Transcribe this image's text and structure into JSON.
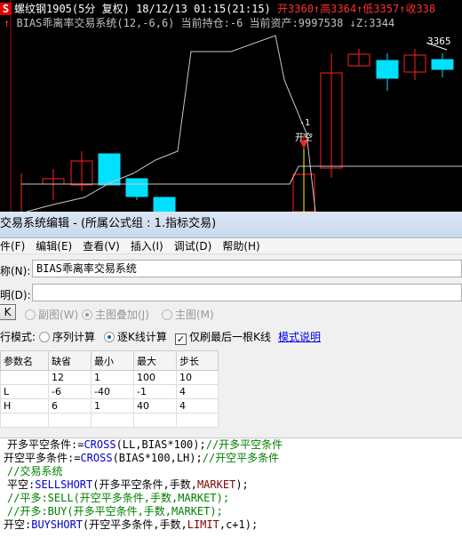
{
  "chart": {
    "header1": {
      "symbol_icon": "S",
      "symbol": "螺纹钢1905(5分",
      "adjust": "复权)",
      "datetime": "18/12/13 01:15(21:15)",
      "open": "开3360",
      "high": "高3364",
      "low": "低3357",
      "close": "收338"
    },
    "header2": {
      "indicator": "BIAS乖离率交易系统(12,-6,6)",
      "position": "当前持仓:-6",
      "assets": "当前资产:9997538",
      "z": "Z:3344"
    },
    "price_label": "3365",
    "signal_qty": "-1",
    "signal_name": "开空",
    "colors": {
      "up": "#ff2020",
      "down": "#00e0ff",
      "line": "#c8c8c8",
      "bg": "#000000",
      "yellow": "#ffff00"
    }
  },
  "dialog": {
    "title": "交易系统编辑 - (所属公式组 : 1.指标交易)",
    "menu": [
      "件(F)",
      "编辑(E)",
      "查看(V)",
      "插入(I)",
      "调试(D)",
      "帮助(H)"
    ],
    "name_label": "称(N):",
    "name_value": "BIAS乖离率交易系统",
    "desc_label": "明(D):",
    "desc_value": "",
    "ok_button": "K",
    "radio_sub": "副图(W)",
    "radio_overlay": "主图叠加(J)",
    "radio_main": "主图(M)",
    "mode_label": "行模式:",
    "mode_seq": "序列计算",
    "mode_kline": "逐K线计算",
    "refresh_last": "仅刷最后一根K线",
    "model_help": "模式说明",
    "params": {
      "headers": [
        "参数名",
        "缺省",
        "最小",
        "最大",
        "步长"
      ],
      "rows": [
        [
          "",
          "12",
          "1",
          "100",
          "10"
        ],
        [
          "L",
          "-6",
          "-40",
          "-1",
          "4"
        ],
        [
          "H",
          "6",
          "1",
          "40",
          "4"
        ],
        [
          "",
          "",
          "",
          "",
          ""
        ]
      ]
    },
    "code": [
      {
        "parts": [
          {
            "t": "开多平空条件:=",
            "c": ""
          },
          {
            "t": "CROSS",
            "c": "kw"
          },
          {
            "t": "(LL,BIAS*100);",
            "c": ""
          },
          {
            "t": "//开多平空条件",
            "c": "cm"
          }
        ]
      },
      {
        "parts": [
          {
            "t": "开空平多条件:=",
            "c": ""
          },
          {
            "t": "CROSS",
            "c": "kw"
          },
          {
            "t": "(BIAS*100,LH);",
            "c": ""
          },
          {
            "t": "//开空平多条件",
            "c": "cm"
          }
        ]
      },
      {
        "parts": [
          {
            "t": "//交易系统",
            "c": "cm"
          }
        ]
      },
      {
        "parts": [
          {
            "t": "平空:",
            "c": ""
          },
          {
            "t": "SELLSHORT",
            "c": "kw"
          },
          {
            "t": "(开多平空条件,手数,",
            "c": ""
          },
          {
            "t": "MARKET",
            "c": "mk"
          },
          {
            "t": ");",
            "c": ""
          }
        ]
      },
      {
        "parts": [
          {
            "t": "//平多:SELL(开空平多条件,手数,MARKET);",
            "c": "cm"
          }
        ]
      },
      {
        "parts": [
          {
            "t": "//开多:BUY(开多平空条件,手数,MARKET);",
            "c": "cm"
          }
        ]
      },
      {
        "parts": [
          {
            "t": "开空:",
            "c": ""
          },
          {
            "t": "BUYSHORT",
            "c": "kw"
          },
          {
            "t": "(开空平多条件,手数,",
            "c": ""
          },
          {
            "t": "LIMIT",
            "c": "mk"
          },
          {
            "t": ",c+1);",
            "c": ""
          }
        ]
      }
    ]
  }
}
